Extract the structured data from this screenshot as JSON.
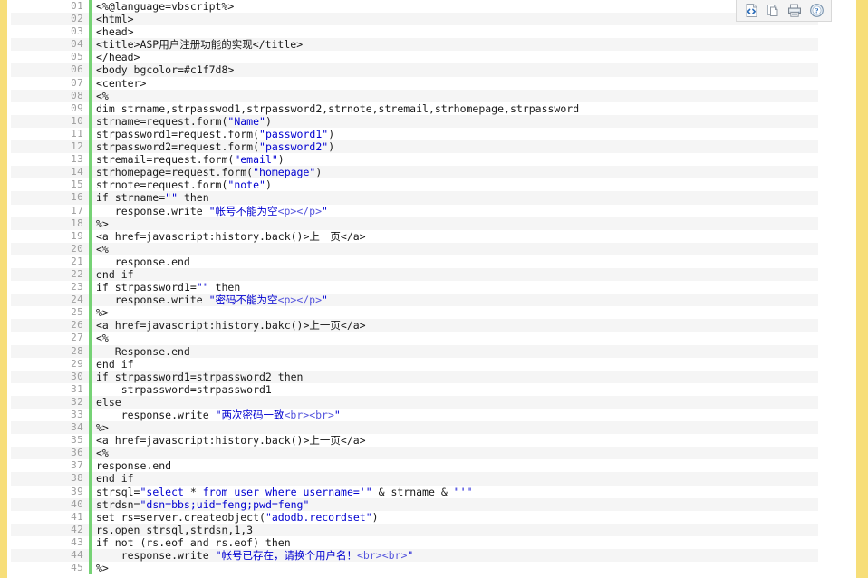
{
  "window": {
    "title": "ASP Code Viewer",
    "background": "#ffffff",
    "rail_color": "#f7de79",
    "gutter_bar_color": "#76d275",
    "alt_row_color": "#f5f5f5",
    "string_color": "#0000d0",
    "tag_color": "#5555dd",
    "line_number_color": "#9d9d9d"
  },
  "toolbar": {
    "buttons": [
      {
        "name": "view-source-icon",
        "label": "<>",
        "title": "View Source"
      },
      {
        "name": "copy-icon",
        "label": "Copy",
        "title": "Copy"
      },
      {
        "name": "print-icon",
        "label": "Print",
        "title": "Print"
      },
      {
        "name": "help-icon",
        "label": "?",
        "title": "Help"
      }
    ]
  },
  "code": {
    "language": "vbscript-asp",
    "first_line": 1,
    "last_line": 45,
    "lines": [
      {
        "n": "01",
        "tokens": [
          {
            "t": "plain",
            "v": "<%@language=vbscript%>"
          }
        ]
      },
      {
        "n": "02",
        "tokens": [
          {
            "t": "plain",
            "v": "<html>"
          }
        ]
      },
      {
        "n": "03",
        "tokens": [
          {
            "t": "plain",
            "v": "<head>"
          }
        ]
      },
      {
        "n": "04",
        "tokens": [
          {
            "t": "plain",
            "v": "<title>ASP用户注册功能的实现</title>"
          }
        ]
      },
      {
        "n": "05",
        "tokens": [
          {
            "t": "plain",
            "v": "</head>"
          }
        ]
      },
      {
        "n": "06",
        "tokens": [
          {
            "t": "plain",
            "v": "<body bgcolor=#c1f7d8>"
          }
        ]
      },
      {
        "n": "07",
        "tokens": [
          {
            "t": "plain",
            "v": "<center>"
          }
        ]
      },
      {
        "n": "08",
        "tokens": [
          {
            "t": "plain",
            "v": "<%"
          }
        ]
      },
      {
        "n": "09",
        "tokens": [
          {
            "t": "plain",
            "v": "dim strname,strpasswod1,strpassword2,strnote,stremail,strhomepage,strpassword"
          }
        ]
      },
      {
        "n": "10",
        "tokens": [
          {
            "t": "plain",
            "v": "strname=request.form("
          },
          {
            "t": "str",
            "v": "\"Name\""
          },
          {
            "t": "plain",
            "v": ")"
          }
        ]
      },
      {
        "n": "11",
        "tokens": [
          {
            "t": "plain",
            "v": "strpassword1=request.form("
          },
          {
            "t": "str",
            "v": "\"password1\""
          },
          {
            "t": "plain",
            "v": ")"
          }
        ]
      },
      {
        "n": "12",
        "tokens": [
          {
            "t": "plain",
            "v": "strpassword2=request.form("
          },
          {
            "t": "str",
            "v": "\"password2\""
          },
          {
            "t": "plain",
            "v": ")"
          }
        ]
      },
      {
        "n": "13",
        "tokens": [
          {
            "t": "plain",
            "v": "stremail=request.form("
          },
          {
            "t": "str",
            "v": "\"email\""
          },
          {
            "t": "plain",
            "v": ")"
          }
        ]
      },
      {
        "n": "14",
        "tokens": [
          {
            "t": "plain",
            "v": "strhomepage=request.form("
          },
          {
            "t": "str",
            "v": "\"homepage\""
          },
          {
            "t": "plain",
            "v": ")"
          }
        ]
      },
      {
        "n": "15",
        "tokens": [
          {
            "t": "plain",
            "v": "strnote=request.form("
          },
          {
            "t": "str",
            "v": "\"note\""
          },
          {
            "t": "plain",
            "v": ")"
          }
        ]
      },
      {
        "n": "16",
        "tokens": [
          {
            "t": "plain",
            "v": "if strname="
          },
          {
            "t": "str",
            "v": "\"\""
          },
          {
            "t": "plain",
            "v": " then"
          }
        ]
      },
      {
        "n": "17",
        "tokens": [
          {
            "t": "plain",
            "v": "   response.write "
          },
          {
            "t": "str",
            "v": "\"帐号不能为空"
          },
          {
            "t": "tag",
            "v": "<p></p>"
          },
          {
            "t": "str",
            "v": "\""
          }
        ]
      },
      {
        "n": "18",
        "tokens": [
          {
            "t": "plain",
            "v": "%>"
          }
        ]
      },
      {
        "n": "19",
        "tokens": [
          {
            "t": "plain",
            "v": "<a href=javascript:history.back()>上一页</a>"
          }
        ]
      },
      {
        "n": "20",
        "tokens": [
          {
            "t": "plain",
            "v": "<%"
          }
        ]
      },
      {
        "n": "21",
        "tokens": [
          {
            "t": "plain",
            "v": "   response.end"
          }
        ]
      },
      {
        "n": "22",
        "tokens": [
          {
            "t": "plain",
            "v": "end if"
          }
        ]
      },
      {
        "n": "23",
        "tokens": [
          {
            "t": "plain",
            "v": "if strpassword1="
          },
          {
            "t": "str",
            "v": "\"\""
          },
          {
            "t": "plain",
            "v": " then"
          }
        ]
      },
      {
        "n": "24",
        "tokens": [
          {
            "t": "plain",
            "v": "   response.write "
          },
          {
            "t": "str",
            "v": "\"密码不能为空"
          },
          {
            "t": "tag",
            "v": "<p></p>"
          },
          {
            "t": "str",
            "v": "\""
          }
        ]
      },
      {
        "n": "25",
        "tokens": [
          {
            "t": "plain",
            "v": "%>"
          }
        ]
      },
      {
        "n": "26",
        "tokens": [
          {
            "t": "plain",
            "v": "<a href=javascript:history.bakc()>上一页</a>"
          }
        ]
      },
      {
        "n": "27",
        "tokens": [
          {
            "t": "plain",
            "v": "<%"
          }
        ]
      },
      {
        "n": "28",
        "tokens": [
          {
            "t": "plain",
            "v": "   Response.end"
          }
        ]
      },
      {
        "n": "29",
        "tokens": [
          {
            "t": "plain",
            "v": "end if"
          }
        ]
      },
      {
        "n": "30",
        "tokens": [
          {
            "t": "plain",
            "v": "if strpassword1=strpassword2 then"
          }
        ]
      },
      {
        "n": "31",
        "tokens": [
          {
            "t": "plain",
            "v": "    strpassword=strpassword1"
          }
        ]
      },
      {
        "n": "32",
        "tokens": [
          {
            "t": "plain",
            "v": "else"
          }
        ]
      },
      {
        "n": "33",
        "tokens": [
          {
            "t": "plain",
            "v": "    response.write "
          },
          {
            "t": "str",
            "v": "\"两次密码一致"
          },
          {
            "t": "tag",
            "v": "<br><br>"
          },
          {
            "t": "str",
            "v": "\""
          }
        ]
      },
      {
        "n": "34",
        "tokens": [
          {
            "t": "plain",
            "v": "%>"
          }
        ]
      },
      {
        "n": "35",
        "tokens": [
          {
            "t": "plain",
            "v": "<a href=javascript:history.back()>上一页</a>"
          }
        ]
      },
      {
        "n": "36",
        "tokens": [
          {
            "t": "plain",
            "v": "<%"
          }
        ]
      },
      {
        "n": "37",
        "tokens": [
          {
            "t": "plain",
            "v": "response.end"
          }
        ]
      },
      {
        "n": "38",
        "tokens": [
          {
            "t": "plain",
            "v": "end if"
          }
        ]
      },
      {
        "n": "39",
        "tokens": [
          {
            "t": "plain",
            "v": "strsql="
          },
          {
            "t": "str",
            "v": "\"select "
          },
          {
            "t": "plain",
            "v": "*"
          },
          {
            "t": "str",
            "v": " from user where username='\""
          },
          {
            "t": "plain",
            "v": " & strname & "
          },
          {
            "t": "str",
            "v": "\"'\""
          }
        ]
      },
      {
        "n": "40",
        "tokens": [
          {
            "t": "plain",
            "v": "strdsn="
          },
          {
            "t": "str",
            "v": "\"dsn=bbs;uid=feng;pwd=feng\""
          }
        ]
      },
      {
        "n": "41",
        "tokens": [
          {
            "t": "plain",
            "v": "set rs=server.createobject("
          },
          {
            "t": "str",
            "v": "\"adodb.recordset\""
          },
          {
            "t": "plain",
            "v": ")"
          }
        ]
      },
      {
        "n": "42",
        "tokens": [
          {
            "t": "plain",
            "v": "rs.open strsql,strdsn,1,3"
          }
        ]
      },
      {
        "n": "43",
        "tokens": [
          {
            "t": "plain",
            "v": "if not (rs.eof and rs.eof) then"
          }
        ]
      },
      {
        "n": "44",
        "tokens": [
          {
            "t": "plain",
            "v": "    response.write "
          },
          {
            "t": "str",
            "v": "\"帐号已存在，请换个用户名！"
          },
          {
            "t": "tag",
            "v": "<br><br>"
          },
          {
            "t": "str",
            "v": "\""
          }
        ]
      },
      {
        "n": "45",
        "tokens": [
          {
            "t": "plain",
            "v": "%>"
          }
        ]
      }
    ]
  }
}
